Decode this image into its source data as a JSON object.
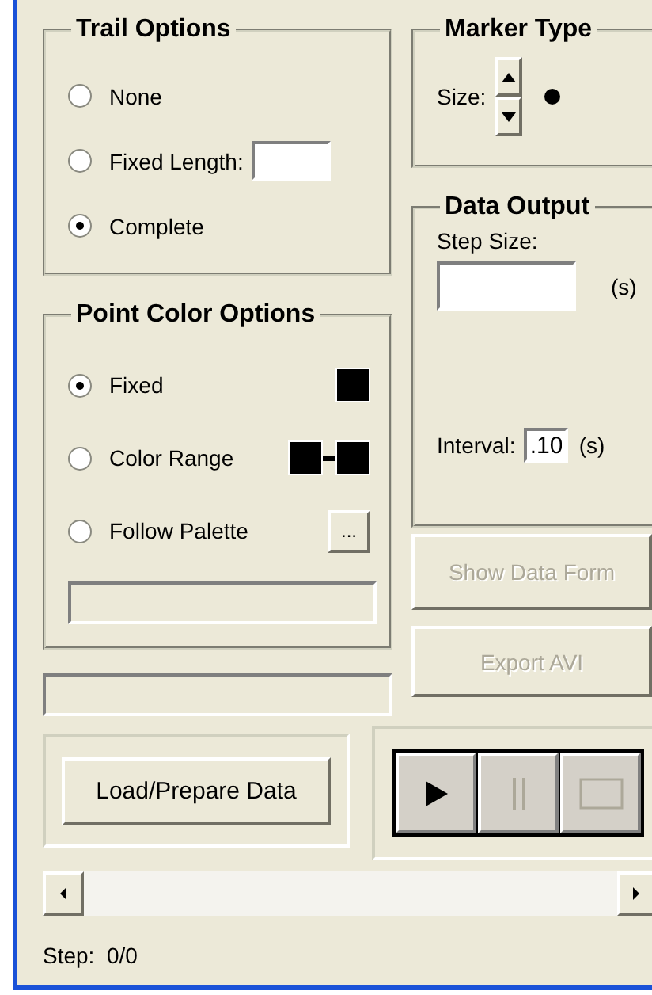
{
  "trail_options": {
    "title": "Trail Options",
    "options": [
      {
        "label": "None",
        "selected": false,
        "kind": "plain"
      },
      {
        "label": "Fixed Length:",
        "selected": false,
        "kind": "field"
      },
      {
        "label": "Complete",
        "selected": true,
        "kind": "plain"
      }
    ]
  },
  "point_color_options": {
    "title": "Point Color Options",
    "options": [
      {
        "label": "Fixed",
        "selected": true,
        "kind": "swatch",
        "color": "#000000"
      },
      {
        "label": "Color Range",
        "selected": false,
        "kind": "range",
        "color": "#000000"
      },
      {
        "label": "Follow Palette",
        "selected": false,
        "kind": "palette",
        "button": "..."
      }
    ]
  },
  "marker_type": {
    "title": "Marker Type",
    "size_label": "Size:"
  },
  "data_output": {
    "title": "Data Output",
    "step_size_label": "Step Size:",
    "step_size_unit": "(s)",
    "interval_label": "Interval:",
    "interval_value": ".10",
    "interval_unit": "(s)"
  },
  "buttons": [
    {
      "label": "Show Data Form",
      "disabled": true
    },
    {
      "label": "Export AVI",
      "disabled": true
    }
  ],
  "load_button": "Load/Prepare Data",
  "playback": [
    {
      "kind": "play",
      "disabled": false
    },
    {
      "kind": "pause",
      "disabled": true
    },
    {
      "kind": "stop",
      "disabled": true
    }
  ],
  "status": "Step:  0/0"
}
